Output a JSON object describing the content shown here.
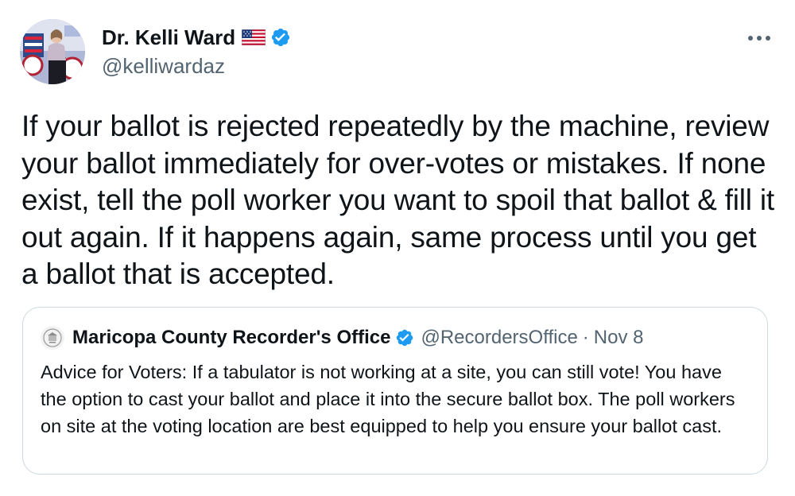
{
  "author": {
    "display_name": "Dr. Kelli Ward",
    "handle": "@kelliwardaz",
    "flag_icon": "us-flag-icon",
    "verified_icon": "verified-badge-icon"
  },
  "more_icon": "more-options-icon",
  "tweet": {
    "text": "If your ballot is rejected repeatedly by the machine, review your ballot immediately for over-votes or mistakes. If none exist, tell the poll worker you want to spoil that ballot & fill it out again. If it happens again, same process until you get a ballot that is accepted."
  },
  "quoted_tweet": {
    "author_name": "Maricopa County Recorder's Office",
    "handle": "@RecordersOffice",
    "separator": "·",
    "date": "Nov 8",
    "text": "Advice for Voters: If a tabulator is not working at a site, you can still vote! You have the option to cast your ballot and place it into the secure ballot box. The poll workers on site at the voting location are best equipped to help you ensure your ballot cast."
  },
  "colors": {
    "text_primary": "#0f1419",
    "text_secondary": "#536471",
    "verified_blue": "#1d9bf0",
    "border": "#cfd9de"
  }
}
